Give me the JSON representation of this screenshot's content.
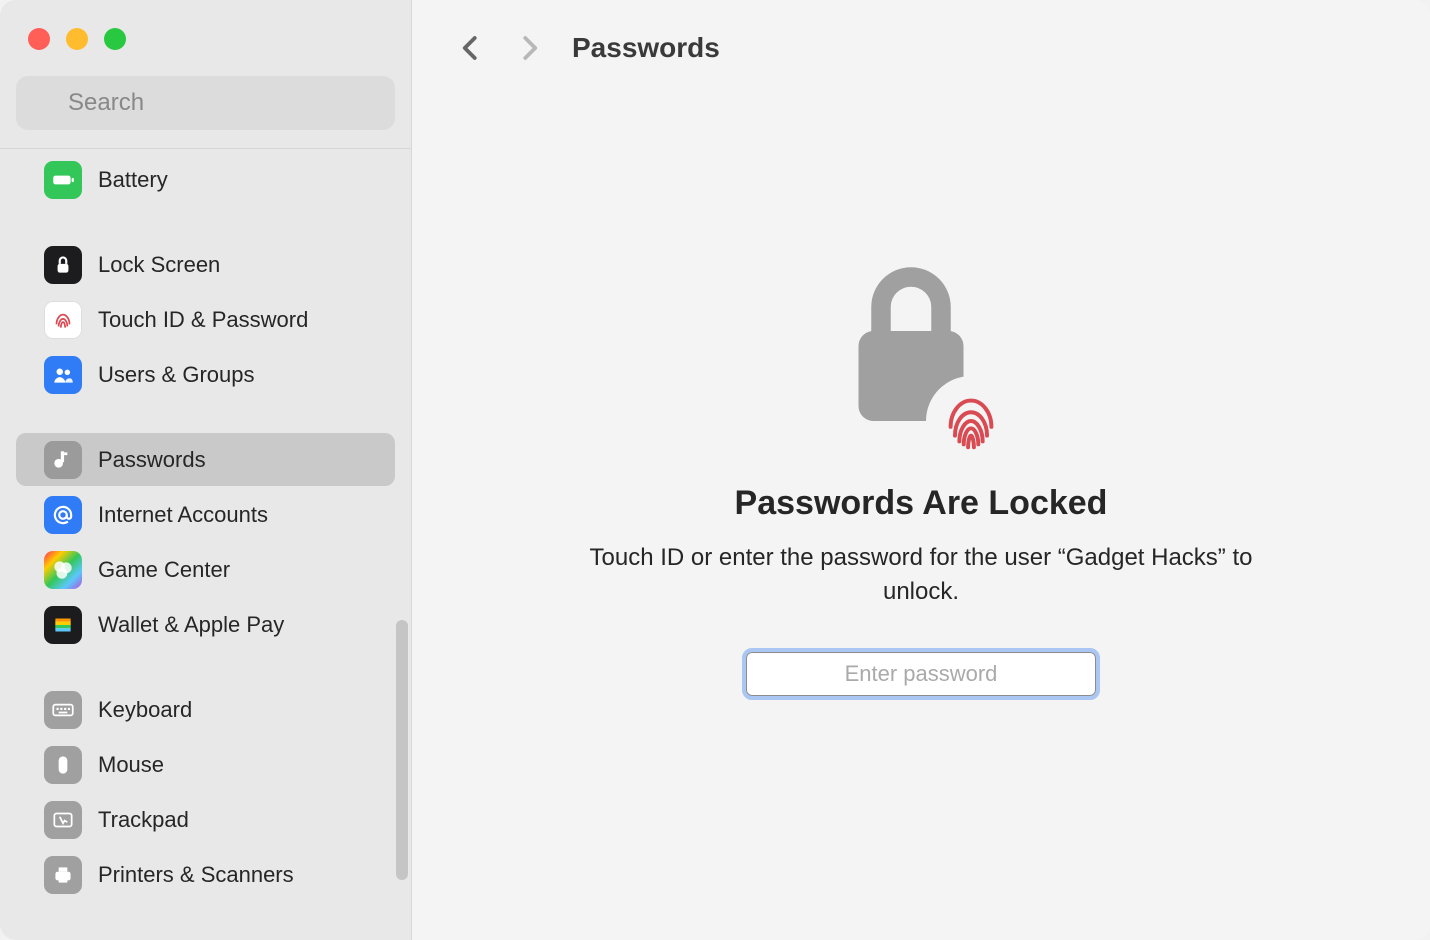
{
  "search": {
    "placeholder": "Search"
  },
  "sidebar": {
    "items": [
      {
        "label": "Battery"
      },
      {
        "label": "Lock Screen"
      },
      {
        "label": "Touch ID & Password"
      },
      {
        "label": "Users & Groups"
      },
      {
        "label": "Passwords"
      },
      {
        "label": "Internet Accounts"
      },
      {
        "label": "Game Center"
      },
      {
        "label": "Wallet & Apple Pay"
      },
      {
        "label": "Keyboard"
      },
      {
        "label": "Mouse"
      },
      {
        "label": "Trackpad"
      },
      {
        "label": "Printers & Scanners"
      }
    ]
  },
  "header": {
    "title": "Passwords"
  },
  "locked": {
    "title": "Passwords Are Locked",
    "subtitle": "Touch ID or enter the password for the user “Gadget Hacks” to unlock.",
    "placeholder": "Enter password"
  }
}
